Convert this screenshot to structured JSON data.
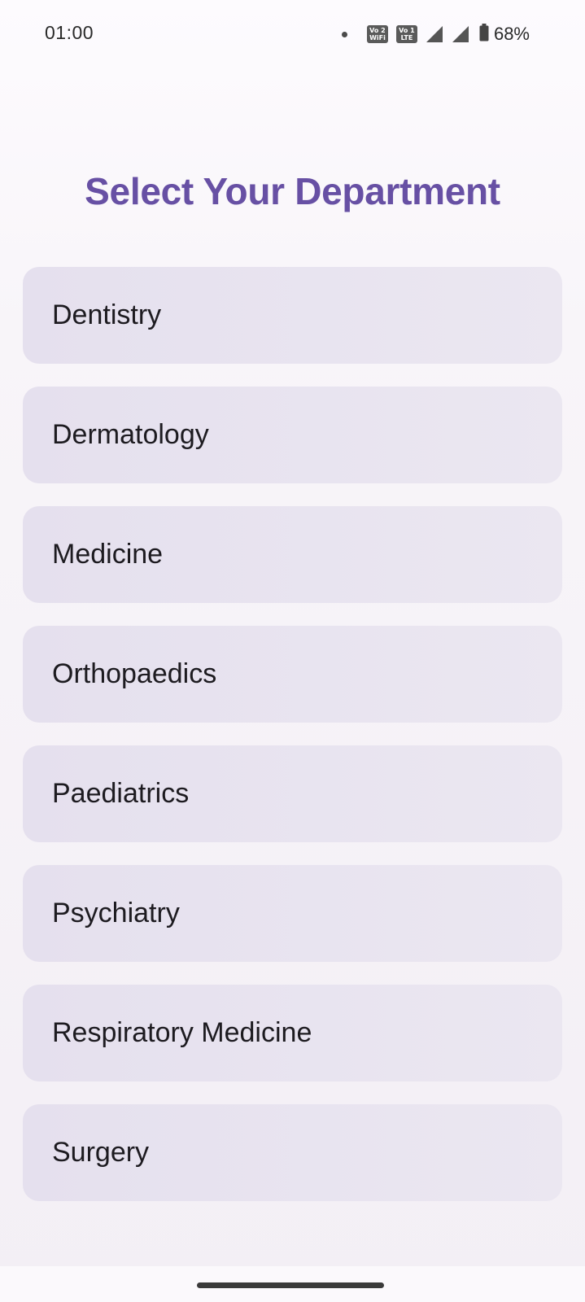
{
  "status_bar": {
    "time": "01:00",
    "vowifi_badge_top": "Vo 2",
    "vowifi_badge_bottom": "WiFi",
    "volte_badge_top": "Vo 1",
    "volte_badge_bottom": "LTE",
    "battery": "68%"
  },
  "page": {
    "title": "Select Your Department"
  },
  "departments": [
    {
      "label": "Dentistry"
    },
    {
      "label": "Dermatology"
    },
    {
      "label": "Medicine"
    },
    {
      "label": "Orthopaedics"
    },
    {
      "label": "Paediatrics"
    },
    {
      "label": "Psychiatry"
    },
    {
      "label": "Respiratory Medicine"
    },
    {
      "label": "Surgery"
    }
  ],
  "colors": {
    "title": "#6750a4",
    "card": "#e5e0ee",
    "text": "#1d1b20"
  }
}
